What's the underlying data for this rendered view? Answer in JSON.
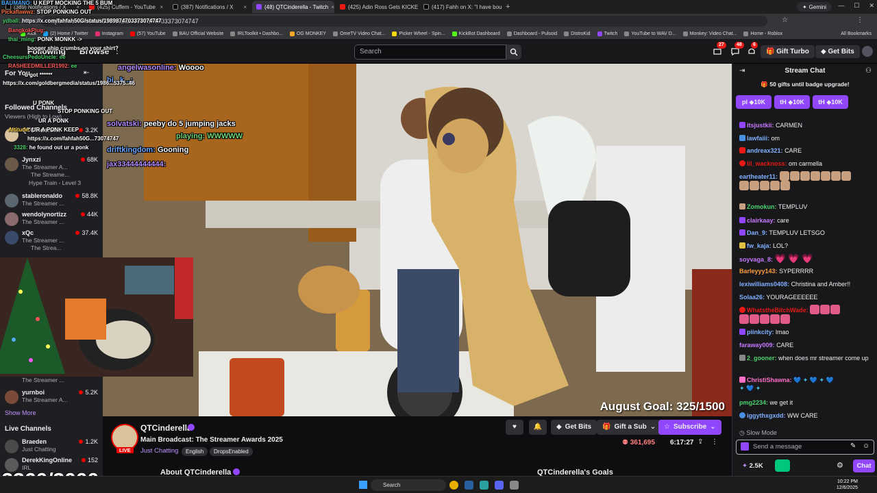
{
  "browser": {
    "tabs": [
      {
        "label": "(389) Notifications / X",
        "icon": "x-icon"
      },
      {
        "label": "(425) Cuffem - YouTube",
        "icon": "youtube-icon"
      },
      {
        "label": "(387) Notifications / X",
        "icon": "x-icon"
      },
      {
        "label": "(48) QTCinderella - Twitch",
        "icon": "twitch-icon",
        "active": true
      },
      {
        "label": "(425) Adin Ross Gets KICKED O...",
        "icon": "youtube-icon"
      },
      {
        "label": "(417) Fahh on X: \"I have boug...",
        "icon": "x-icon"
      }
    ],
    "gemini_label": "Gemini",
    "url": "https://x.com/fahfah50G/status/1989874703373074747",
    "bookmarks": [
      "Kick",
      "(2) Home / Twitter",
      "Instagram",
      "(57) YouTube",
      "BAU Official Website",
      "IRLToolkit • Dashbo...",
      "OG MONKEY",
      "OmeTV Video Chat...",
      "Picker Wheel - Spin...",
      "KickBot Dashboard",
      "Dashboard - Pulsoid",
      "DistroKid",
      "Twitch",
      "YouTube to WAV D...",
      "Monkey: Video Chat...",
      "Home - Roblox"
    ],
    "all_bookmarks": "All Bookmarks"
  },
  "topnav": {
    "following": "Following",
    "browse": "Browse",
    "search_placeholder": "Search",
    "notif_counts": [
      "27",
      "48",
      "6"
    ],
    "gift_turbo": "Gift Turbo",
    "get_bits": "Get Bits"
  },
  "sidebar": {
    "for_you": "For You",
    "followed_channels": "Followed Channels",
    "viewers_sort": "Viewers (High to Low)",
    "followed": [
      {
        "name": "QTCinderella",
        "category": "",
        "viewers": "3.2K"
      },
      {
        "name": "Jynxzi",
        "category": "The Streamer A...",
        "viewers": "68K",
        "sub": "The Streame...",
        "hype": "Hype Train - Level 3"
      },
      {
        "name": "stableronaldo",
        "category": "The Streamer ...",
        "viewers": "58.8K"
      },
      {
        "name": "wendolynortizz",
        "category": "The Streamer ...",
        "viewers": "44K"
      },
      {
        "name": "xQc",
        "category": "The Streamer ...",
        "viewers": "37.4K",
        "sub": "The Strea..."
      }
    ],
    "lower_followed": [
      {
        "name": "",
        "category": "The Streamer ...",
        "viewers": ""
      },
      {
        "name": "yurnboi",
        "category": "The Streamer A...",
        "viewers": "5.2K"
      }
    ],
    "show_more": "Show More",
    "live_channels": "Live Channels",
    "live": [
      {
        "name": "Braeden",
        "category": "Just Chatting",
        "viewers": "1.2K"
      },
      {
        "name": "DerekKingOnline",
        "category": "IRL",
        "viewers": "152"
      }
    ]
  },
  "overlay_chat": [
    {
      "user": "BAUMANO:",
      "text": "U KEPT MOCKING THE 5 BUM"
    },
    {
      "user": "Pickaflawwz:",
      "text": "STOP PONKING OUT"
    },
    {
      "user": "ydball:",
      "text": "https://x.com/fahfah50G/status/1989874703373074747"
    },
    {
      "user": "BangkokPlug:",
      "text": ""
    },
    {
      "user": "thai_ming:",
      "text": "PONK MONKK ->"
    },
    {
      "user": "",
      "text": "booger ship crumbs on your shirt?"
    },
    {
      "user": "CheesursPedoUncle:",
      "text": "ee"
    },
    {
      "user": "RASHEEDMILLER1992:",
      "text": "ee"
    },
    {
      "user": "",
      "text": "u got ******"
    },
    {
      "user": "",
      "text": "https://x.com/goldbergmedia/status/1986...5375..46"
    },
    {
      "user": "",
      "text": "... Pinn..."
    },
    {
      "user": "",
      "text": "U PONK"
    },
    {
      "user": "",
      "text": "STOP PONKING OUT"
    },
    {
      "user": "",
      "text": "UR A PONK"
    },
    {
      "user": "Altitude:",
      "text": "UR A PONK KEEP"
    },
    {
      "user": "",
      "text": "https://x.com/fahfah50G...73074747"
    },
    {
      "user": "3328:",
      "text": "he found out ur a ponk"
    }
  ],
  "video_chat": [
    {
      "user": "angelwasonline:",
      "text": "Woooo",
      "color": "#b58cff"
    },
    {
      "user": "bi...k...:",
      "text": "",
      "color": "#6fa8ff"
    },
    {
      "user": "solvatski:",
      "text": "peeby do 5 jumping jacks",
      "color": "#b58cff"
    },
    {
      "user": "",
      "text": "playing: WWWWW",
      "color": "#6fd36f"
    },
    {
      "user": "driftkingdom:",
      "text": "Gooning",
      "color": "#6fa8ff"
    },
    {
      "user": "jax33444444444:",
      "text": "",
      "color": "#b58cff"
    }
  ],
  "goal_overlay": "August Goal: 325/1500",
  "big_counter": "2360/3000",
  "stream": {
    "name": "QTCinderella",
    "title": "Main Broadcast: The Streamer Awards 2025",
    "category": "Just Chatting",
    "tags": [
      "English",
      "DropsEnabled"
    ],
    "live_label": "LIVE",
    "viewers": "361,695",
    "uptime": "6:17:27",
    "get_bits": "Get Bits",
    "gift_sub": "Gift a Sub",
    "subscribe": "Subscribe",
    "about": "About QTCinderella",
    "goals": "QTCinderella's Goals"
  },
  "chat": {
    "title": "Stream Chat",
    "gift_progress": "50 gifts until badge upgrade!",
    "hype_chips": [
      {
        "prefix": "pl",
        "amount": "10K"
      },
      {
        "prefix": "tH",
        "amount": "10K"
      },
      {
        "prefix": "tH",
        "amount": "10K"
      }
    ],
    "messages": [
      {
        "user": "itsjustkii:",
        "text": "CARMEN",
        "color": "#c678ff"
      },
      {
        "user": "lawfaiii:",
        "text": "om",
        "color": "#7fb0ff"
      },
      {
        "user": "andreax321:",
        "text": "CARE",
        "color": "#7fb0ff"
      },
      {
        "user": "lil_wacknoss:",
        "text": "om carmella",
        "color": "#e91916"
      },
      {
        "user": "eartheater11:",
        "text": "",
        "color": "#7fb0ff",
        "emotes": 12
      },
      {
        "user": "Zomokun:",
        "text": "TEMPLUV",
        "color": "#4ad36a"
      },
      {
        "user": "clairkaay:",
        "text": "care",
        "color": "#c678ff"
      },
      {
        "user": "Dan_9:",
        "text": "TEMPLUV LETSGO",
        "color": "#7fb0ff"
      },
      {
        "user": "fw_kaja:",
        "text": "LOL?",
        "color": "#7fb0ff"
      },
      {
        "user": "soyvaga_8:",
        "text": "",
        "color": "#c678ff",
        "emotes": 3
      },
      {
        "user": "Barleyyy143:",
        "text": "SYPERRRR",
        "color": "#ff9c3a"
      },
      {
        "user": "lexiwilliams0408:",
        "text": "Christina and Amber!!",
        "color": "#7fb0ff"
      },
      {
        "user": "Solaa26:",
        "text": "YOURAGEEEEEE",
        "color": "#7fb0ff"
      },
      {
        "user": "WhatstheBitchWade:",
        "text": "",
        "color": "#e91916",
        "emotes": 8
      },
      {
        "user": "piinkcity:",
        "text": "lmao",
        "color": "#7fb0ff"
      },
      {
        "user": "faraway009:",
        "text": "CARE",
        "color": "#c678ff"
      },
      {
        "user": "2_gooner:",
        "text": "when does mr streamer come up",
        "color": "#4ad36a"
      },
      {
        "user": "ChristiShawna:",
        "text": "",
        "color": "#ff6ec7",
        "emotes": 7
      },
      {
        "user": "pmg2234:",
        "text": "we get it",
        "color": "#4ad36a"
      },
      {
        "user": "iggythxgxdd:",
        "text": "WW CARE",
        "color": "#7fb0ff"
      }
    ],
    "slow_mode": "Slow Mode",
    "placeholder": "Send a message",
    "points": "2.5K",
    "chat_button": "Chat"
  },
  "taskbar": {
    "search": "Search",
    "time": "10:22 PM",
    "date": "12/6/2025"
  }
}
